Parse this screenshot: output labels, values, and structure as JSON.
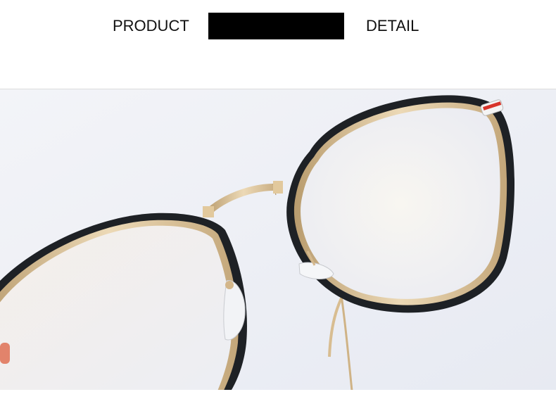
{
  "header": {
    "left_label": "PRODUCT",
    "right_label": "DETAIL"
  },
  "photo": {
    "subject": "eyeglasses-photo"
  },
  "colors": {
    "frame_black": "#1e2125",
    "frame_gold": "#d6b98c",
    "background": "#eef0f6",
    "accent_red": "#d8342a"
  }
}
